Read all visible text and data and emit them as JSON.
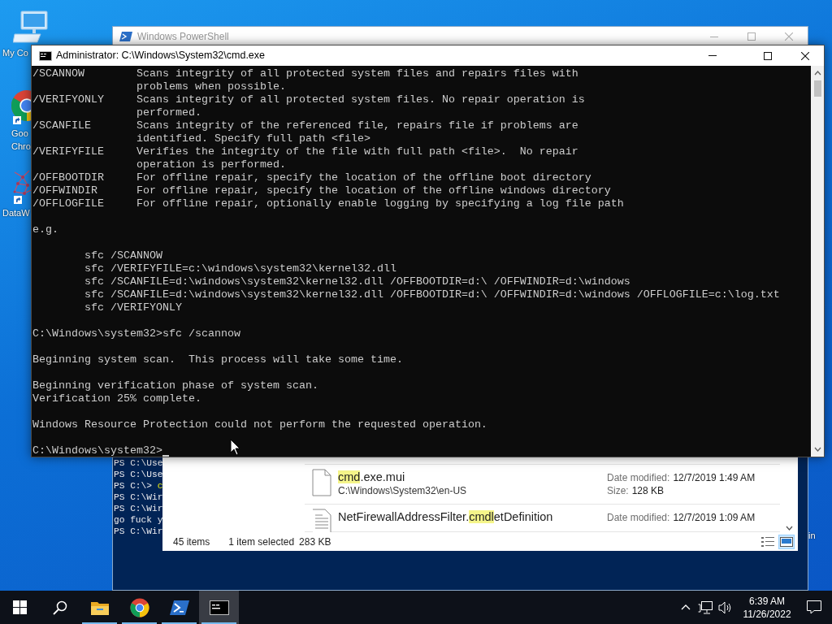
{
  "desktop_icons": [
    {
      "kind": "computer",
      "label_lines": [
        "My Co"
      ]
    },
    {
      "kind": "chrome",
      "label_lines": [
        "Goo",
        "Chro"
      ]
    },
    {
      "kind": "network",
      "label_lines": [
        "DataW"
      ]
    },
    {
      "kind": "hidden",
      "label_lines": [
        "in"
      ]
    }
  ],
  "powershell_window": {
    "title": "Windows PowerShell",
    "active": false,
    "lines": [
      {
        "text": "PS C:\\Use"
      },
      {
        "text": "PS C:\\Use"
      },
      {
        "text": "PS C:\\> ",
        "command": "c"
      },
      {
        "text": "PS C:\\Wir"
      },
      {
        "text": "PS C:\\Wir"
      },
      {
        "text": "go fuck y"
      },
      {
        "text": "PS C:\\Wir"
      }
    ]
  },
  "explorer_window": {
    "results": [
      {
        "kind": "blank",
        "name_parts": [
          {
            "text": "cmd",
            "highlighted": true
          },
          {
            "text": ".exe.mui",
            "highlighted": false
          }
        ],
        "path": "C:\\Windows\\System32\\en-US",
        "date_label": "Date modified:",
        "date": "12/7/2019 1:49 AM",
        "size_label": "Size:",
        "size": "128 KB"
      },
      {
        "kind": "text",
        "name_parts": [
          {
            "text": "NetFirewallAddressFilter.",
            "highlighted": false
          },
          {
            "text": "cmdl",
            "highlighted": true
          },
          {
            "text": "etDefinition",
            "highlighted": false
          }
        ],
        "date_label": "Date modified:",
        "date": "12/7/2019 1:09 AM"
      }
    ],
    "status": {
      "item_count": "45 items",
      "selection": "1 item selected",
      "selection_size": "283 KB"
    },
    "views": [
      {
        "kind": "details",
        "selected": false
      },
      {
        "kind": "large_icons",
        "selected": true
      }
    ]
  },
  "cmd_window": {
    "title": "Administrator: C:\\Windows\\System32\\cmd.exe",
    "active": true,
    "cursor_visible": true,
    "blocks": [
      [
        "/SCANNOW        Scans integrity of all protected system files and repairs files with",
        "                problems when possible.",
        "/VERIFYONLY     Scans integrity of all protected system files. No repair operation is",
        "                performed.",
        "/SCANFILE       Scans integrity of the referenced file, repairs file if problems are",
        "                identified. Specify full path <file>",
        "/VERIFYFILE     Verifies the integrity of the file with full path <file>.  No repair",
        "                operation is performed.",
        "/OFFBOOTDIR     For offline repair, specify the location of the offline boot directory",
        "/OFFWINDIR      For offline repair, specify the location of the offline windows directory",
        "/OFFLOGFILE     For offline repair, optionally enable logging by specifying a log file path"
      ],
      [
        "e.g."
      ],
      [
        "        sfc /SCANNOW",
        "        sfc /VERIFYFILE=c:\\windows\\system32\\kernel32.dll",
        "        sfc /SCANFILE=d:\\windows\\system32\\kernel32.dll /OFFBOOTDIR=d:\\ /OFFWINDIR=d:\\windows",
        "        sfc /SCANFILE=d:\\windows\\system32\\kernel32.dll /OFFBOOTDIR=d:\\ /OFFWINDIR=d:\\windows /OFFLOGFILE=c:\\log.txt",
        "        sfc /VERIFYONLY"
      ],
      [
        "C:\\Windows\\system32>sfc /scannow"
      ],
      [
        "Beginning system scan.  This process will take some time."
      ],
      [
        "Beginning verification phase of system scan.",
        "Verification 25% complete."
      ],
      [
        "Windows Resource Protection could not perform the requested operation."
      ],
      [
        "C:\\Windows\\system32>"
      ]
    ]
  },
  "taskbar": {
    "apps": [
      {
        "kind": "start",
        "open": false,
        "selected": false
      },
      {
        "kind": "search",
        "open": false,
        "selected": false
      },
      {
        "kind": "explorer",
        "open": true,
        "selected": false
      },
      {
        "kind": "chrome",
        "open": true,
        "selected": false
      },
      {
        "kind": "powershell",
        "open": true,
        "selected": false
      },
      {
        "kind": "cmd",
        "open": true,
        "selected": true
      }
    ],
    "clock": {
      "time": "6:39 AM",
      "date": "11/26/2022"
    }
  }
}
